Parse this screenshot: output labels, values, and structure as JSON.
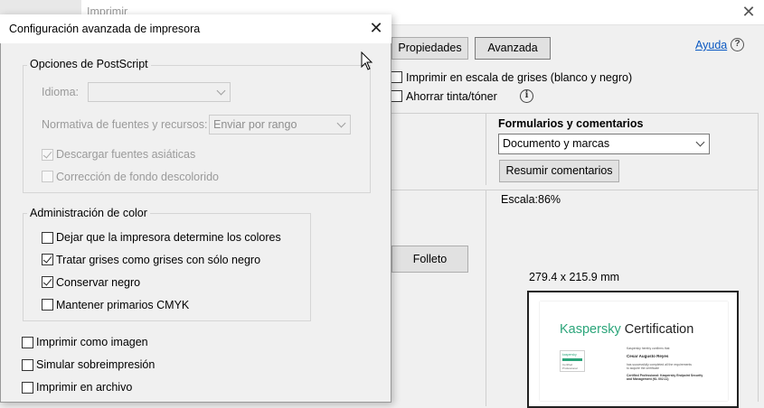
{
  "background_dialog": {
    "title": "Imprimir",
    "buttons": {
      "properties": "Propiedades",
      "advanced": "Avanzada",
      "booklet": "Folleto",
      "summarize_comments": "Resumir comentarios"
    },
    "help_link": "Ayuda",
    "options": {
      "grayscale": "Imprimir en escala de grises (blanco y negro)",
      "save_ink": "Ahorrar tinta/tóner"
    },
    "forms_comments": {
      "heading": "Formularios y comentarios",
      "selected": "Documento y marcas"
    },
    "scale": {
      "label": "Escala:",
      "value": "86%"
    },
    "page_size": "279.4 x 215.9 mm",
    "preview": {
      "brand": "Kaspersky",
      "title": "Certification",
      "badge_brand": "kaspersky",
      "badge_line1": "Certified",
      "badge_line2": "Professional",
      "line1": "Kaspersky hereby confirms that",
      "name": "Cesar Augusto Reyes",
      "line2": "has successfully completed all the requirements",
      "line3": "to acquire the certificate",
      "line4": "Certified Professional: Kaspersky Endpoint Security",
      "line5": "and Management (KL 002.11)"
    },
    "colors": {
      "link": "#0a58c2",
      "kaspersky_green": "#2ba57a"
    }
  },
  "modal": {
    "title": "Configuración avanzada de impresora",
    "postscript": {
      "title": "Opciones de PostScript",
      "language_label": "Idioma:",
      "language_value": "",
      "fonts_label": "Normativa de fuentes y recursos:",
      "fonts_value": "Enviar por rango",
      "download_asian": "Descargar fuentes asiáticas",
      "discolored_bg": "Corrección de fondo descolorido"
    },
    "color_management": {
      "title": "Administración de color",
      "printer_decides": "Dejar que la impresora determine los colores",
      "gray_as_black": "Tratar grises como grises con sólo negro",
      "preserve_black": "Conservar negro",
      "cmyk": "Mantener primarios CMYK"
    },
    "print_as_image": "Imprimir como imagen",
    "simulate_overprint": "Simular sobreimpresión",
    "print_to_file": "Imprimir en archivo"
  }
}
